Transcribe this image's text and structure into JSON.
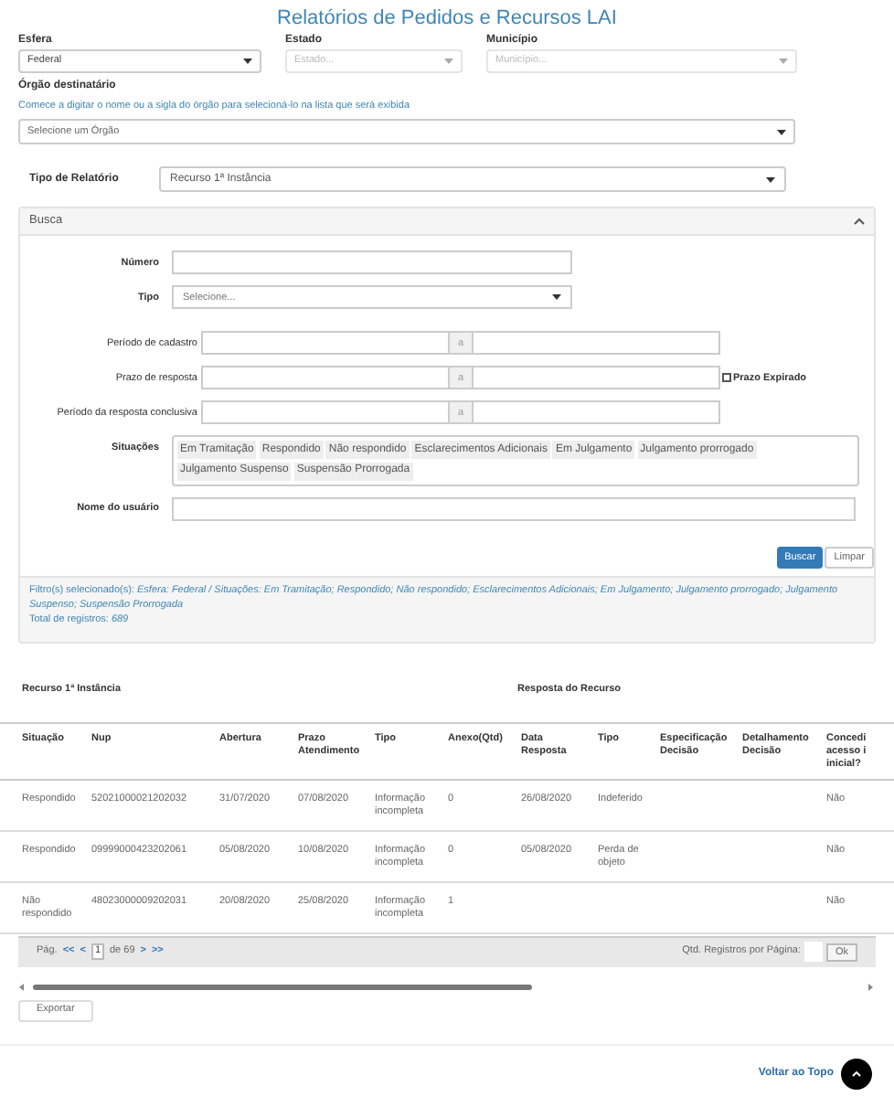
{
  "title": "Relatórios de Pedidos e Recursos LAI",
  "filters": [
    {
      "label": "Esfera",
      "value": "Federal",
      "disabled": false
    },
    {
      "label": "Estado",
      "placeholder": "Estado...",
      "disabled": true
    },
    {
      "label": "Município",
      "placeholder": "Município...",
      "disabled": true
    }
  ],
  "orgao": {
    "label": "Órgão destinatário",
    "hint": "Comece a digitar o nome ou a sigla do órgão para selecioná-lo na lista que será exibida",
    "placeholder": "Selecione um Órgão"
  },
  "tipo_relatorio": {
    "label": "Tipo de Relatório",
    "value": "Recurso 1ª Instância"
  },
  "busca": {
    "title": "Busca",
    "expanded": true,
    "numero": {
      "label": "Número"
    },
    "tipo": {
      "label": "Tipo",
      "placeholder": "Selecione..."
    },
    "periodos": [
      {
        "label": "Período de cadastro",
        "separator": "a"
      },
      {
        "label": "Prazo de resposta",
        "separator": "a",
        "checkbox": {
          "label": "Prazo Expirado",
          "checked": false
        }
      },
      {
        "label": "Período da resposta conclusiva",
        "separator": "a"
      }
    ],
    "situacoes": {
      "label": "Situações",
      "tags": [
        "Em Tramitação",
        "Respondido",
        "Não respondido",
        "Esclarecimentos Adicionais",
        "Em Julgamento",
        "Julgamento prorrogado",
        "Julgamento Suspenso",
        "Suspensão Prorrogada"
      ]
    },
    "usuario": {
      "label": "Nome do usuário"
    },
    "buttons": [
      "Buscar",
      "Limpar"
    ],
    "filtros": "Filtro(s) selecionado(s): *Esfera: Federal / Situações: Em Tramitação; Respondido; Não respondido; Esclarecimentos Adicionais; Em Julgamento; Julgamento prorrogado; Julgamento Suspenso; Suspensão Prorrogada*",
    "total": "Total de registros: *689*"
  },
  "table": {
    "groups": [
      "Recurso 1ª Instância",
      "Resposta do Recurso"
    ],
    "columns": [
      "Situação",
      "Nup",
      "Abertura",
      "Prazo Atendimento",
      "Tipo",
      "Anexo(Qtd)",
      "Data Resposta",
      "Tipo",
      "Especificação Decisão",
      "Detalhamento Decisão",
      "Concedi acesso i inicial?"
    ],
    "rows": [
      [
        "Respondido",
        "52021000021202032",
        "31/07/2020",
        "07/08/2020",
        "Informação incompleta",
        "0",
        "26/08/2020",
        "Indeferido",
        "",
        "",
        "Não"
      ],
      [
        "Respondido",
        "09999000423202061",
        "05/08/2020",
        "10/08/2020",
        "Informação incompleta",
        "0",
        "05/08/2020",
        "Perda de objeto",
        "",
        "",
        "Não"
      ],
      [
        "Não respondido",
        "48023000009202031",
        "20/08/2020",
        "25/08/2020",
        "Informação incompleta",
        "1",
        "",
        "",
        "",
        "",
        "Não"
      ]
    ]
  },
  "pagination": {
    "label": "Pág.",
    "first": "<<",
    "prev": "<",
    "page": "1",
    "of": "de 69",
    "next": ">",
    "last": ">>",
    "per_page_label": "Qtd. Registros por Página:",
    "ok": "Ok"
  },
  "export": "Exportar",
  "back_to_top": "Voltar ao Topo"
}
